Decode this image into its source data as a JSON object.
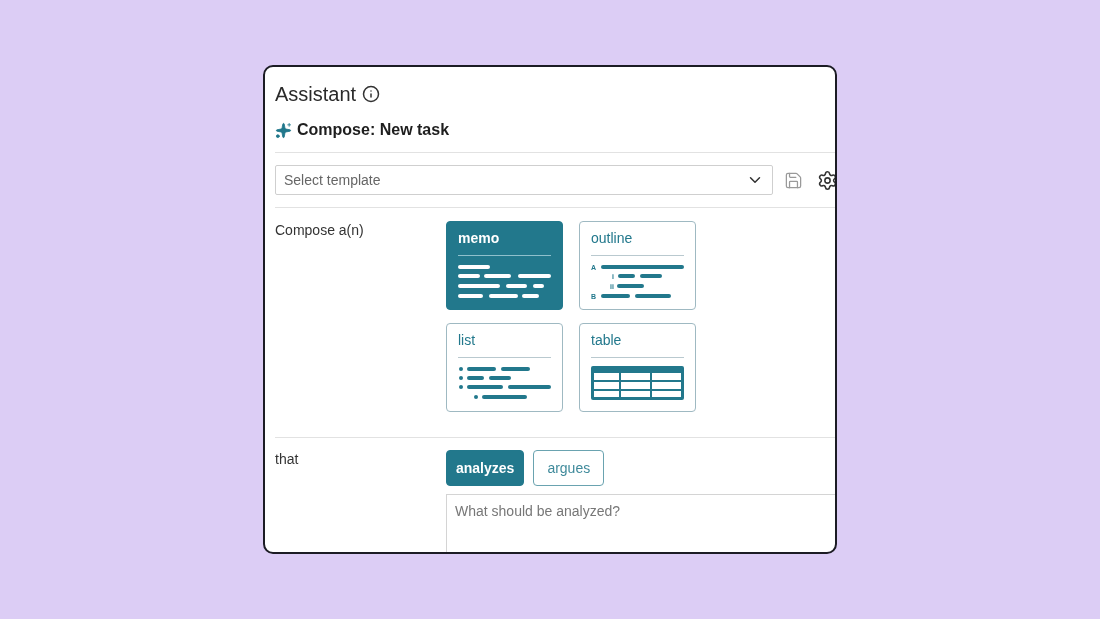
{
  "panel": {
    "title": "Assistant",
    "subtitle": "Compose: New task"
  },
  "template_select": {
    "placeholder": "Select template"
  },
  "compose": {
    "label": "Compose a(n)",
    "formats": [
      {
        "label": "memo",
        "kind": "memo",
        "selected": true
      },
      {
        "label": "outline",
        "kind": "outline",
        "selected": false,
        "markers": [
          "A",
          "i",
          "ii",
          "B"
        ]
      },
      {
        "label": "list",
        "kind": "list",
        "selected": false
      },
      {
        "label": "table",
        "kind": "table",
        "selected": false
      }
    ]
  },
  "purpose": {
    "label": "that",
    "options": [
      {
        "label": "analyzes",
        "selected": true
      },
      {
        "label": "argues",
        "selected": false
      }
    ],
    "input": {
      "placeholder": "What should be analyzed?"
    }
  }
}
